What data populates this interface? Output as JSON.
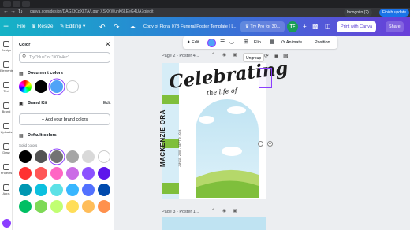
{
  "browser": {
    "tab_title": "Copy of Floral 07B Funeral Poster Template | L...",
    "url": "canva.com/design/DAGXtCpXLTA/Lqan XSKKWunK6LEeG4UA7g/edit",
    "incognito_label": "Incognito (2)",
    "finish_update_label": "Finish update"
  },
  "topbar": {
    "file_label": "File",
    "resize_label": "Resize",
    "editing_label": "Editing",
    "doc_title": "Copy of Floral 07B Funeral Poster Template | L...",
    "try_pro_label": "Try Pro for 30...",
    "avatar_initials": "TF",
    "print_label": "Print with Canva",
    "share_label": "Share"
  },
  "rail": {
    "items": [
      "Design",
      "Elements",
      "Text",
      "Brand",
      "Uploads",
      "Draw",
      "Projects",
      "Apps"
    ]
  },
  "panel": {
    "title": "Color",
    "search_placeholder": "Try \"blue\" or \"#00c4cc\"",
    "document_colors_label": "Document colors",
    "brand_kit_label": "Brand Kit",
    "edit_label": "Edit",
    "add_brand_colors_label": "Add your brand colors",
    "default_colors_label": "Default colors",
    "solid_colors_label": "Solid colors",
    "document_colors": [
      "#000000",
      "#4fa3f7",
      "#ffffff"
    ],
    "default_colors": [
      [
        "#000000",
        "#545454",
        "#737373",
        "#a6a6a6",
        "#d9d9d9",
        "#ffffff"
      ],
      [
        "#ff3131",
        "#ff5757",
        "#ff66c4",
        "#cb6ce6",
        "#8c52ff",
        "#5e17eb"
      ],
      [
        "#0097b2",
        "#0cc0df",
        "#5ce1e6",
        "#38b6ff",
        "#5271ff",
        "#004aad"
      ],
      [
        "#00bf63",
        "#7ed957",
        "#c1ff72",
        "#ffde59",
        "#ffbd59",
        "#ff914d"
      ]
    ]
  },
  "context_toolbar": {
    "edit_label": "Edit",
    "flip_label": "Flip",
    "animate_label": "Animate",
    "position_label": "Position"
  },
  "canvas": {
    "page2_label": "Page 2 - Poster 4...",
    "page3_label": "Page 3 - Poster 1...",
    "tooltip_label": "Ungroup",
    "poster_title": "Celebrating",
    "poster_subtitle": "the life of",
    "poster_name": "MACKENZIE ORA",
    "poster_dates": "JUN 10, 2000 - SEPT 9, 2024"
  }
}
